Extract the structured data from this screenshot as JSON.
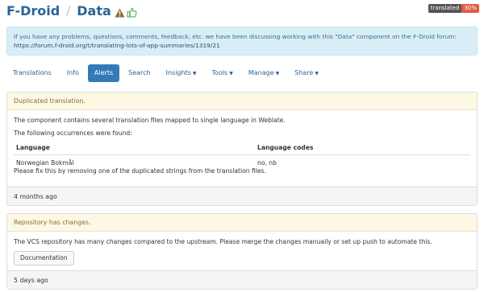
{
  "header": {
    "project": "F-Droid",
    "separator": "/",
    "component": "Data",
    "badge_label": "translated",
    "badge_value": "30%"
  },
  "info_alert": {
    "text": "If you have any problems, questions, comments, feedback, etc. we have been discussing working with this \"Data\" component on the F-Droid forum: ",
    "link_text": "https://forum.f-droid.org/t/translating-lots-of-app-summaries/1319/21"
  },
  "tabs": [
    {
      "label": "Translations",
      "dropdown": false
    },
    {
      "label": "Info",
      "dropdown": false
    },
    {
      "label": "Alerts",
      "dropdown": false,
      "active": true
    },
    {
      "label": "Search",
      "dropdown": false
    },
    {
      "label": "Insights",
      "dropdown": true
    },
    {
      "label": "Tools",
      "dropdown": true
    },
    {
      "label": "Manage",
      "dropdown": true
    },
    {
      "label": "Share",
      "dropdown": true
    }
  ],
  "alerts": [
    {
      "heading": "Duplicated translation.",
      "description": "The component contains several translation files mapped to single language in Weblate.",
      "occurrences_intro": "The following occurrences were found:",
      "table": {
        "headers": [
          "Language",
          "Language codes"
        ],
        "rows": [
          [
            "Norwegian Bokmål",
            "no, nb"
          ]
        ]
      },
      "fix_text": "Please fix this by removing one of the duplicated strings from the translation files.",
      "age": "4 months ago"
    },
    {
      "heading": "Repository has changes.",
      "description": "The VCS repository has many changes compared to the upstream. Please merge the changes manually or set up push to automate this.",
      "button_label": "Documentation",
      "age": "5 days ago"
    }
  ],
  "colors": {
    "link": "#2a6496",
    "active_tab": "#337ab7",
    "info_bg": "#d9edf7",
    "warning_heading_bg": "#fcf8e3",
    "warning_icon": "#8a6d3b",
    "thumb_icon": "#5cb85c",
    "badge_value_bg": "#e05d44"
  }
}
